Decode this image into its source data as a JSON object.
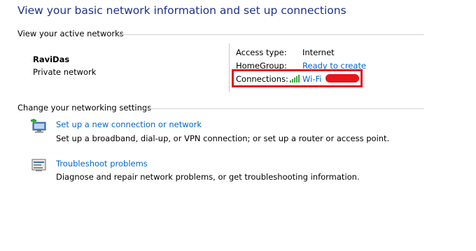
{
  "page": {
    "title": "View your basic network information and set up connections"
  },
  "active_networks": {
    "heading": "View your active networks",
    "network": {
      "name": "RaviDas",
      "category": "Private network"
    },
    "details": {
      "access_type_label": "Access type:",
      "access_type_value": "Internet",
      "homegroup_label": "HomeGroup:",
      "homegroup_value": "Ready to create",
      "connections_label": "Connections:",
      "connections_value": "Wi-Fi",
      "signal_icon": "wifi-signal-icon"
    },
    "annotation_color": "#e0141e"
  },
  "settings": {
    "heading": "Change your networking settings",
    "tasks": [
      {
        "icon": "new-connection-icon",
        "link": "Set up a new connection or network",
        "description": "Set up a broadband, dial-up, or VPN connection; or set up a router or access point."
      },
      {
        "icon": "troubleshoot-icon",
        "link": "Troubleshoot problems",
        "description": "Diagnose and repair network problems, or get troubleshooting information."
      }
    ]
  },
  "colors": {
    "title": "#1e3287",
    "link": "#0066cc",
    "signal": "#3aa83a"
  }
}
